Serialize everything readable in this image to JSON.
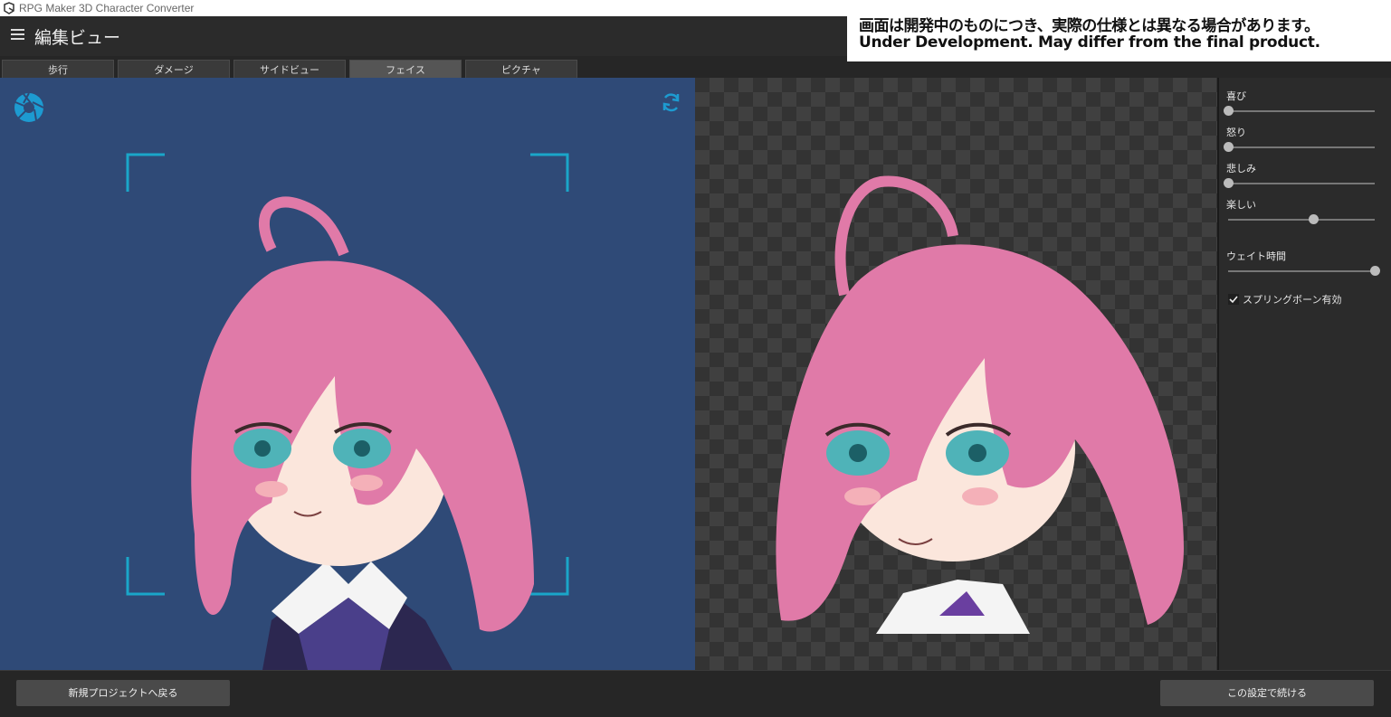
{
  "window": {
    "title": "RPG Maker 3D Character Converter",
    "minimize_glyph": "_"
  },
  "notice": {
    "line1": "画面は開発中のものにつき、実際の仕様とは異なる場合があります。",
    "line2": "Under Development. May differ from the final product."
  },
  "header": {
    "title": "編集ビュー"
  },
  "tabs": [
    {
      "label": "歩行",
      "active": false
    },
    {
      "label": "ダメージ",
      "active": false
    },
    {
      "label": "サイドビュー",
      "active": false
    },
    {
      "label": "フェイス",
      "active": true
    },
    {
      "label": "ピクチャ",
      "active": false
    }
  ],
  "expressions": {
    "items": [
      {
        "label": "喜び",
        "value": 0
      },
      {
        "label": "怒り",
        "value": 0
      },
      {
        "label": "悲しみ",
        "value": 0
      },
      {
        "label": "楽しい",
        "value": 0.58
      }
    ],
    "wait": {
      "label": "ウェイト時間",
      "value": 1.0
    },
    "spring_bone": {
      "label": "スプリングボーン有効",
      "checked": true
    }
  },
  "footer": {
    "back_label": "新規プロジェクトへ戻る",
    "continue_label": "この設定で続ける"
  },
  "colors": {
    "accent": "#1d9bd1",
    "viewport_bg": "#2f4a77",
    "hair": "#e07aa8"
  },
  "icons": {
    "app": "app-logo-icon",
    "menu": "hamburger-menu-icon",
    "capture": "camera-shutter-icon",
    "refresh": "refresh-icon",
    "check": "checkmark-icon"
  }
}
